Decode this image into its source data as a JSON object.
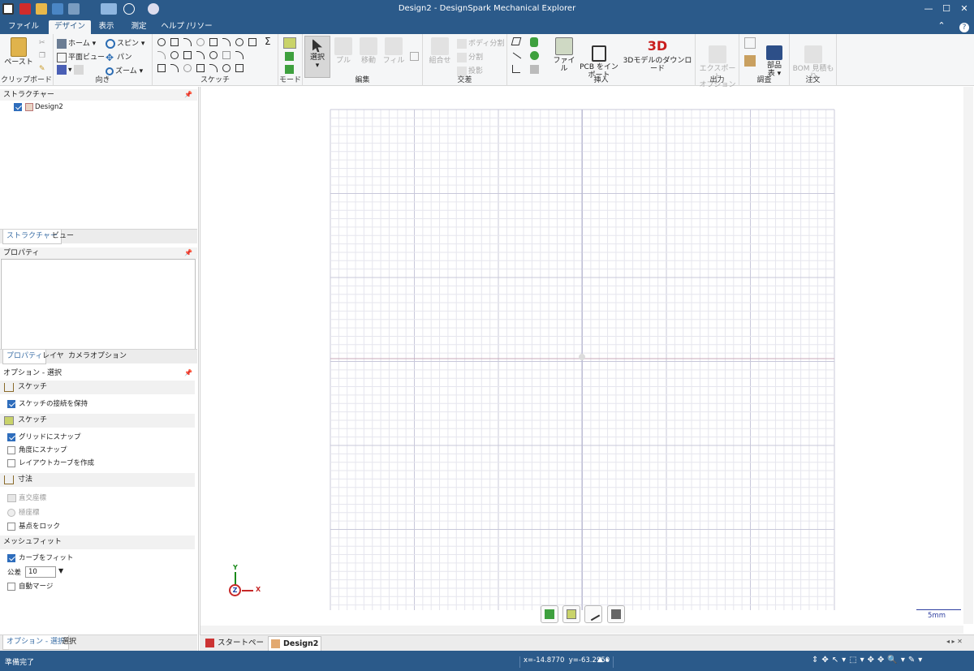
{
  "window": {
    "title": "Design2 - DesignSpark Mechanical Explorer",
    "controls": [
      "—",
      "☐",
      "✕"
    ]
  },
  "ribbon_tabs": [
    {
      "label": "ファイル",
      "active": false
    },
    {
      "label": "デザイン",
      "active": true
    },
    {
      "label": "表示",
      "active": false
    },
    {
      "label": "測定",
      "active": false
    },
    {
      "label": "ヘルプ /リソース",
      "active": false
    }
  ],
  "ribbon": {
    "clipboard": {
      "label": "クリップボード",
      "paste": "ペースト"
    },
    "orient": {
      "label": "向き",
      "home": "ホーム",
      "plan_view": "平面ビュー",
      "spin": "スピン",
      "pan": "パン",
      "zoom": "ズーム"
    },
    "sketch": {
      "label": "スケッチ",
      "sum": "Σ"
    },
    "mode": {
      "label": "モード"
    },
    "edit": {
      "label": "編集",
      "select": "選択",
      "pull": "プル",
      "move": "移動",
      "fill": "フィル"
    },
    "intersect": {
      "label": "交差",
      "combine": "組合せ",
      "split_body": "ボディ分割",
      "split": "分割",
      "project": "投影"
    },
    "insert": {
      "label": "挿入",
      "file": "ファイル",
      "pcb_import": "PCB をイン\nポート",
      "download_3d": "3Dモデルのダウンロード",
      "logo_3d": "3D"
    },
    "output": {
      "label": "出力",
      "export": "エクスポート\nオプション"
    },
    "investigate": {
      "label": "調査",
      "bom": "部品\n表"
    },
    "order": {
      "label": "注文",
      "bom_quote": "BOM 見積も\nり"
    }
  },
  "structure": {
    "header": "ストラクチャー",
    "tree_item": "Design2",
    "tabs": [
      "ストラクチャー",
      "ビュー"
    ]
  },
  "properties": {
    "header": "プロパティ",
    "tabs": [
      "プロパティ",
      "レイヤ",
      "カメラオプション"
    ]
  },
  "options": {
    "header": "オプション - 選択",
    "sections": [
      {
        "title": "スケッチ",
        "items": [
          {
            "label": "スケッチの接続を保持",
            "checked": true
          }
        ]
      },
      {
        "title": "スケッチ",
        "items": [
          {
            "label": "グリッドにスナップ",
            "checked": true
          },
          {
            "label": "角度にスナップ",
            "checked": false
          },
          {
            "label": "レイアウトカーブを作成",
            "checked": false
          }
        ]
      },
      {
        "title": "寸法",
        "items": [
          {
            "label": "直交座標",
            "checked": false,
            "disabled": true
          },
          {
            "label": "極座標",
            "checked": false,
            "disabled": true
          },
          {
            "label": "基点をロック",
            "checked": false
          }
        ]
      },
      {
        "title": "メッシュフィット",
        "items": [
          {
            "label": "カーブをフィット",
            "checked": true
          }
        ]
      }
    ],
    "tolerance_label": "公差",
    "tolerance_value": "10",
    "auto_merge": "自動マージ",
    "bottom_tabs": [
      "オプション - 選択",
      "選択"
    ]
  },
  "canvas": {
    "axis_y": "Y",
    "axis_x": "X",
    "axis_z": "Z",
    "scale_label": "5mm"
  },
  "doc_tabs": [
    {
      "label": "スタートページ",
      "active": false
    },
    {
      "label": "Design2",
      "active": true,
      "close": "✕"
    }
  ],
  "status": {
    "text": "準備完了",
    "coords": "x=-14.8770  y=-63.2950"
  },
  "colors": {
    "titlebar": "#2b5a8a",
    "ribbon_bg": "#f5f6f7",
    "grid_minor": "#e6e6ee",
    "grid_major": "#c8c8da",
    "axis_x": "#c9a8b8",
    "axis_y": "#b4b4d0"
  }
}
